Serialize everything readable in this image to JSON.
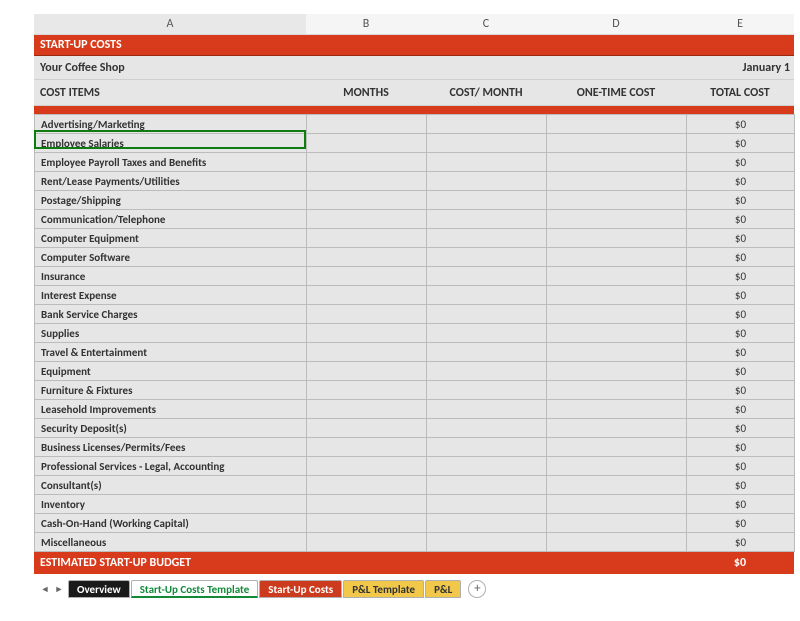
{
  "columns": [
    "A",
    "B",
    "C",
    "D",
    "E"
  ],
  "title_band": "START-UP COSTS",
  "company_row": {
    "name": "Your Coffee Shop",
    "date": "January 1"
  },
  "headers": {
    "c1": "COST ITEMS",
    "c2": "MONTHS",
    "c3": "COST/ MONTH",
    "c4": "ONE-TIME COST",
    "c5": "TOTAL COST"
  },
  "items": [
    {
      "label": "Advertising/Marketing",
      "months": "",
      "cost_month": "",
      "one_time": "",
      "total": "$0"
    },
    {
      "label": "Employee Salaries",
      "months": "",
      "cost_month": "",
      "one_time": "",
      "total": "$0"
    },
    {
      "label": "Employee Payroll Taxes and Benefits",
      "months": "",
      "cost_month": "",
      "one_time": "",
      "total": "$0"
    },
    {
      "label": "Rent/Lease Payments/Utilities",
      "months": "",
      "cost_month": "",
      "one_time": "",
      "total": "$0"
    },
    {
      "label": "Postage/Shipping",
      "months": "",
      "cost_month": "",
      "one_time": "",
      "total": "$0"
    },
    {
      "label": "Communication/Telephone",
      "months": "",
      "cost_month": "",
      "one_time": "",
      "total": "$0"
    },
    {
      "label": "Computer Equipment",
      "months": "",
      "cost_month": "",
      "one_time": "",
      "total": "$0"
    },
    {
      "label": "Computer Software",
      "months": "",
      "cost_month": "",
      "one_time": "",
      "total": "$0"
    },
    {
      "label": "Insurance",
      "months": "",
      "cost_month": "",
      "one_time": "",
      "total": "$0"
    },
    {
      "label": "Interest Expense",
      "months": "",
      "cost_month": "",
      "one_time": "",
      "total": "$0"
    },
    {
      "label": "Bank Service Charges",
      "months": "",
      "cost_month": "",
      "one_time": "",
      "total": "$0"
    },
    {
      "label": "Supplies",
      "months": "",
      "cost_month": "",
      "one_time": "",
      "total": "$0"
    },
    {
      "label": "Travel & Entertainment",
      "months": "",
      "cost_month": "",
      "one_time": "",
      "total": "$0"
    },
    {
      "label": "Equipment",
      "months": "",
      "cost_month": "",
      "one_time": "",
      "total": "$0"
    },
    {
      "label": "Furniture & Fixtures",
      "months": "",
      "cost_month": "",
      "one_time": "",
      "total": "$0"
    },
    {
      "label": "Leasehold Improvements",
      "months": "",
      "cost_month": "",
      "one_time": "",
      "total": "$0"
    },
    {
      "label": "Security Deposit(s)",
      "months": "",
      "cost_month": "",
      "one_time": "",
      "total": "$0"
    },
    {
      "label": "Business Licenses/Permits/Fees",
      "months": "",
      "cost_month": "",
      "one_time": "",
      "total": "$0"
    },
    {
      "label": "Professional Services - Legal, Accounting",
      "months": "",
      "cost_month": "",
      "one_time": "",
      "total": "$0"
    },
    {
      "label": "Consultant(s)",
      "months": "",
      "cost_month": "",
      "one_time": "",
      "total": "$0"
    },
    {
      "label": "Inventory",
      "months": "",
      "cost_month": "",
      "one_time": "",
      "total": "$0"
    },
    {
      "label": "Cash-On-Hand (Working Capital)",
      "months": "",
      "cost_month": "",
      "one_time": "",
      "total": "$0"
    },
    {
      "label": "Miscellaneous",
      "months": "",
      "cost_month": "",
      "one_time": "",
      "total": "$0"
    }
  ],
  "budget": {
    "label": "ESTIMATED START-UP BUDGET",
    "total": "$0"
  },
  "tabs": {
    "overview": "Overview",
    "startup_template": "Start-Up Costs Template",
    "startup_costs": "Start-Up Costs",
    "pl_template": "P&L Template",
    "pl": "P&L"
  }
}
